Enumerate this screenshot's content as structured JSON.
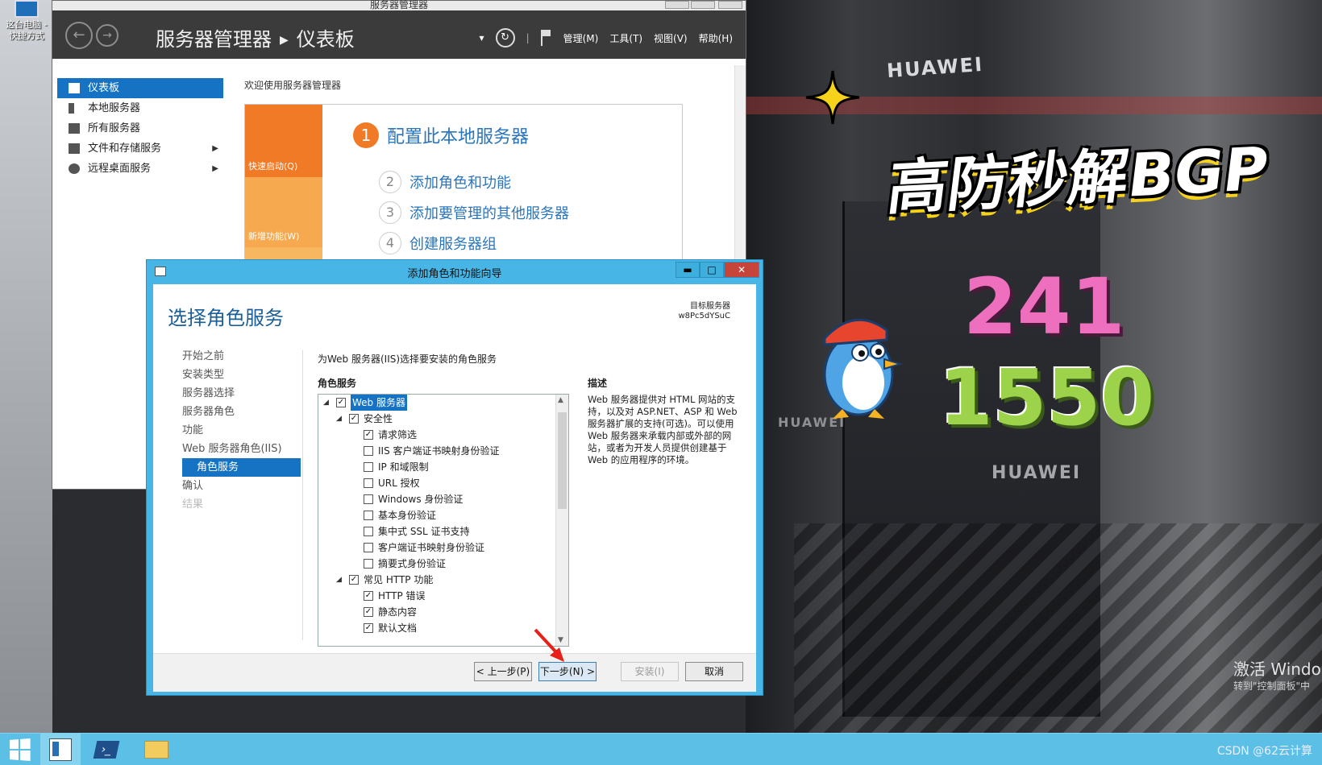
{
  "desktop": {
    "icon_label_line1": "这台电脑 -",
    "icon_label_line2": "快捷方式"
  },
  "server_manager": {
    "window_title": "服务器管理器",
    "breadcrumb_root": "服务器管理器",
    "breadcrumb_current": "仪表板",
    "menus": [
      "管理(M)",
      "工具(T)",
      "视图(V)",
      "帮助(H)"
    ],
    "sidebar": [
      {
        "label": "仪表板",
        "icon": "dashboard-icon",
        "active": true
      },
      {
        "label": "本地服务器",
        "icon": "server-icon",
        "active": false
      },
      {
        "label": "所有服务器",
        "icon": "servers-icon",
        "active": false
      },
      {
        "label": "文件和存储服务",
        "icon": "storage-icon",
        "active": false,
        "has_arrow": true
      },
      {
        "label": "远程桌面服务",
        "icon": "remote-desktop-icon",
        "active": false,
        "has_arrow": true
      }
    ],
    "welcome": "欢迎使用服务器管理器",
    "quick_tiles": [
      "快速启动(Q)",
      "新增功能(W)"
    ],
    "step1": {
      "num": "1",
      "label": "配置此本地服务器"
    },
    "steps": [
      {
        "num": "2",
        "label": "添加角色和功能"
      },
      {
        "num": "3",
        "label": "添加要管理的其他服务器"
      },
      {
        "num": "4",
        "label": "创建服务器组"
      }
    ]
  },
  "wizard": {
    "title": "添加角色和功能向导",
    "heading": "选择角色服务",
    "target_label": "目标服务器",
    "target_value": "w8Pc5dYSuC",
    "nav": [
      {
        "label": "开始之前",
        "state": "normal"
      },
      {
        "label": "安装类型",
        "state": "normal"
      },
      {
        "label": "服务器选择",
        "state": "normal"
      },
      {
        "label": "服务器角色",
        "state": "normal"
      },
      {
        "label": "功能",
        "state": "normal"
      },
      {
        "label": "Web 服务器角色(IIS)",
        "state": "normal"
      },
      {
        "label": "角色服务",
        "state": "active"
      },
      {
        "label": "确认",
        "state": "normal"
      },
      {
        "label": "结果",
        "state": "disabled"
      }
    ],
    "intro": "为Web 服务器(IIS)选择要安装的角色服务",
    "role_services_label": "角色服务",
    "description_label": "描述",
    "description": "Web 服务器提供对 HTML 网站的支持，以及对 ASP.NET、ASP 和 Web 服务器扩展的支持(可选)。可以使用 Web 服务器来承载内部或外部的网站，或者为开发人员提供创建基于 Web 的应用程序的环境。",
    "tree": [
      {
        "label": "Web 服务器",
        "level": 0,
        "checked": true,
        "expander": "◢",
        "selected": true
      },
      {
        "label": "安全性",
        "level": 1,
        "checked": true,
        "expander": "◢"
      },
      {
        "label": "请求筛选",
        "level": 2,
        "checked": true
      },
      {
        "label": "IIS 客户端证书映射身份验证",
        "level": 2,
        "checked": false
      },
      {
        "label": "IP 和域限制",
        "level": 2,
        "checked": false
      },
      {
        "label": "URL 授权",
        "level": 2,
        "checked": false
      },
      {
        "label": "Windows 身份验证",
        "level": 2,
        "checked": false
      },
      {
        "label": "基本身份验证",
        "level": 2,
        "checked": false
      },
      {
        "label": "集中式 SSL 证书支持",
        "level": 2,
        "checked": false
      },
      {
        "label": "客户端证书映射身份验证",
        "level": 2,
        "checked": false
      },
      {
        "label": "摘要式身份验证",
        "level": 2,
        "checked": false
      },
      {
        "label": "常见 HTTP 功能",
        "level": 1,
        "checked": true,
        "expander": "◢"
      },
      {
        "label": "HTTP 错误",
        "level": 2,
        "checked": true
      },
      {
        "label": "静态内容",
        "level": 2,
        "checked": true
      },
      {
        "label": "默认文档",
        "level": 2,
        "checked": true
      }
    ],
    "buttons": {
      "prev": "< 上一步(P)",
      "next": "下一步(N) >",
      "install": "安装(I)",
      "cancel": "取消"
    }
  },
  "overlay": {
    "promo_title": "高防秒解BGP",
    "promo_number1": "241",
    "promo_number2": "1550",
    "activate_line1": "激活 Windo",
    "activate_line2": "转到\"控制面板\"中",
    "brand": "HUAWEI"
  },
  "taskbar": {
    "watermark": "CSDN @62云计算"
  },
  "colors": {
    "accent_blue": "#1673c4",
    "wizard_frame": "#47b6e6",
    "quickstart_orange": "#f07a26",
    "taskbar": "#5bbfe6"
  }
}
